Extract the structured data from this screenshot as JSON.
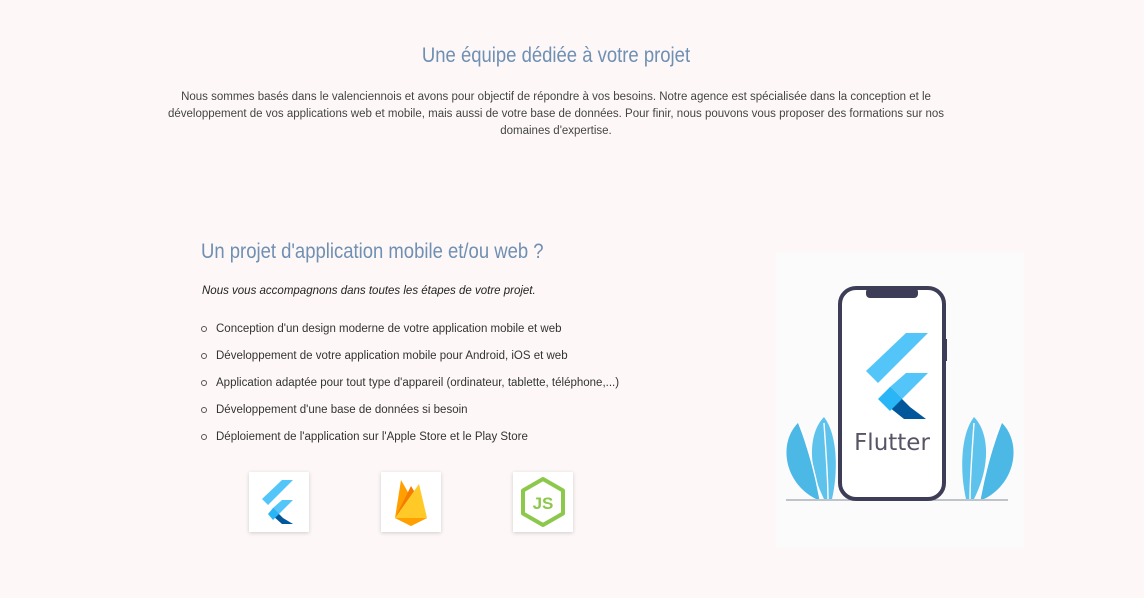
{
  "intro": {
    "title": "Une équipe dédiée à votre projet",
    "text": "Nous sommes basés dans le valenciennois et avons pour objectif de répondre à vos besoins. Notre agence est spécialisée dans la conception et le développement de vos applications web et mobile, mais aussi de votre base de données. Pour finir, nous pouvons vous proposer des formations sur nos domaines d'expertise."
  },
  "project": {
    "title": "Un projet d'application mobile et/ou web ?",
    "lead": "Nous vous accompagnons dans toutes les étapes de votre projet.",
    "features": [
      "Conception d'un design moderne de votre application mobile et web",
      "Développement de votre application mobile pour Android, iOS et web",
      "Application adaptée pour tout type d'appareil (ordinateur, tablette, téléphone,...)",
      "Développement d'une base de données si besoin",
      "Déploiement de l'application sur l'Apple Store et le Play Store"
    ]
  },
  "tech_logos": [
    {
      "icon": "flutter-logo-icon"
    },
    {
      "icon": "firebase-logo-icon"
    },
    {
      "icon": "nodejs-logo-icon",
      "text": "JS"
    }
  ],
  "illustration": {
    "label": "Flutter",
    "icon": "phone-flutter-illustration"
  },
  "colors": {
    "heading": "#6f8fb3",
    "flutter_light": "#54c5f8",
    "flutter_dark": "#01579b",
    "firebase_yellow": "#ffca28",
    "firebase_orange": "#f57c00",
    "node_green": "#8cc84b",
    "leaf_blue": "#4bb8e6"
  }
}
